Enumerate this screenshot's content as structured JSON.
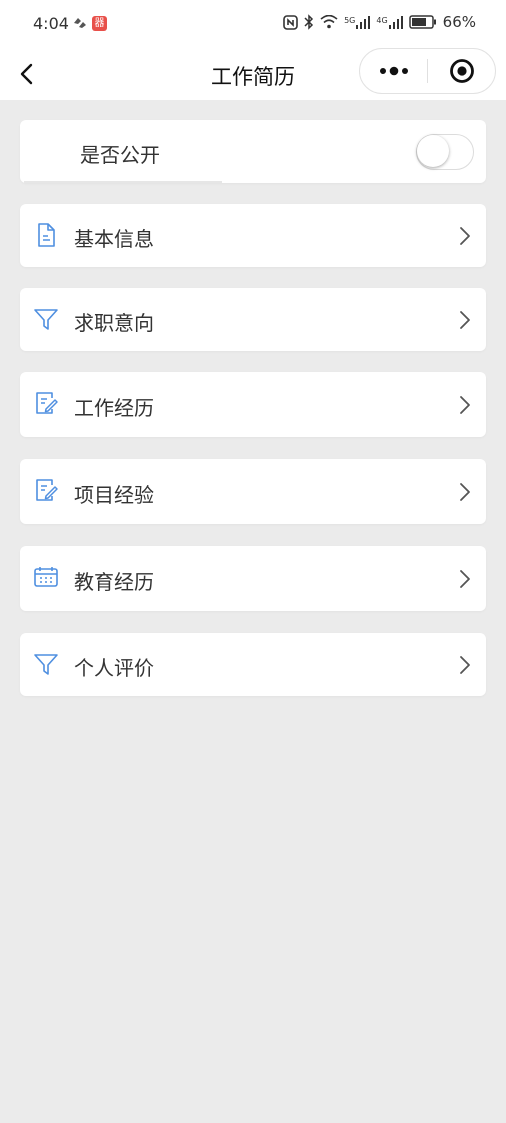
{
  "status_bar": {
    "time": "4:04",
    "mini_icon_badge": "器",
    "network_5g": "5G",
    "network_4g": "4G",
    "battery": "66%"
  },
  "nav": {
    "title": "工作简历",
    "back_icon": "chevron-left",
    "more_icon": "dots",
    "close_icon": "target"
  },
  "visibility": {
    "label": "是否公开",
    "enabled": false
  },
  "menu": [
    {
      "label": "基本信息",
      "icon": "document-icon"
    },
    {
      "label": "求职意向",
      "icon": "filter-icon"
    },
    {
      "label": "工作经历",
      "icon": "edit-document-icon"
    },
    {
      "label": "项目经验",
      "icon": "edit-document-icon"
    },
    {
      "label": "教育经历",
      "icon": "calendar-icon"
    },
    {
      "label": "个人评价",
      "icon": "filter-icon"
    }
  ],
  "colors": {
    "background": "#ebebeb",
    "card": "#ffffff",
    "icon_blue": "#4f8fe0",
    "text": "#333333"
  }
}
